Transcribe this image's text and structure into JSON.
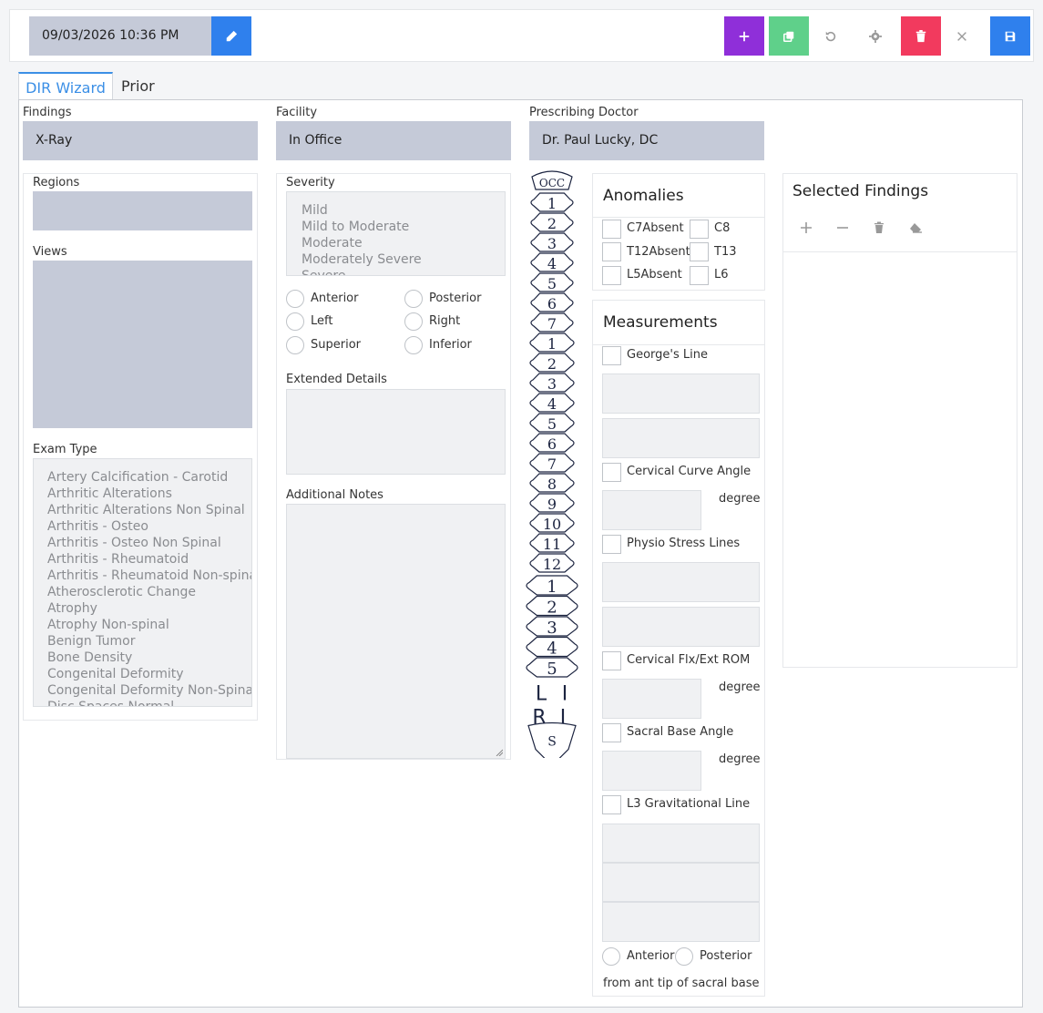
{
  "toolbar": {
    "datetime": "09/03/2026 10:36 PM",
    "icons": [
      "pencil-icon",
      "plus-icon",
      "copy-icon",
      "undo-icon",
      "gear-icon",
      "trash-icon",
      "close-icon",
      "save-icon"
    ],
    "colors": {
      "edit": "#2f80ed",
      "add": "#8f2fd9",
      "copy": "#5fd08a",
      "delete": "#f23a5e",
      "save": "#2f80ed"
    }
  },
  "tabs": [
    "DIR Wizard",
    "Prior"
  ],
  "findings": {
    "label": "Findings",
    "value": "X-Ray"
  },
  "facility": {
    "label": "Facility",
    "value": "In Office"
  },
  "doctor": {
    "label": "Prescribing Doctor",
    "value": "Dr. Paul Lucky, DC"
  },
  "regions": {
    "label": "Regions"
  },
  "views": {
    "label": "Views"
  },
  "exam": {
    "label": "Exam Type",
    "options": [
      "Artery Calcification - Carotid",
      "Arthritic Alterations",
      "Arthritic Alterations Non Spinal",
      "Arthritis - Osteo",
      "Arthritis - Osteo Non Spinal",
      "Arthritis - Rheumatoid",
      "Arthritis - Rheumatoid Non-spina",
      "Atherosclerotic Change",
      "Atrophy",
      "Atrophy Non-spinal",
      "Benign Tumor",
      "Bone Density",
      "Congenital Deformity",
      "Congenital Deformity Non-Spinal",
      "Disc Spaces Normal"
    ]
  },
  "severity": {
    "label": "Severity",
    "options": [
      "Mild",
      "Mild to Moderate",
      "Moderate",
      "Moderately Severe",
      "Severe"
    ],
    "radios": [
      "Anterior",
      "Posterior",
      "Left",
      "Right",
      "Superior",
      "Inferior"
    ]
  },
  "extended": {
    "label": "Extended Details"
  },
  "notes": {
    "label": "Additional Notes"
  },
  "spine": {
    "top": "OCC",
    "cervical": [
      "1",
      "2",
      "3",
      "4",
      "5",
      "6",
      "7"
    ],
    "thoracic": [
      "1",
      "2",
      "3",
      "4",
      "5",
      "6",
      "7",
      "8",
      "9",
      "10",
      "11",
      "12"
    ],
    "lumbar": [
      "1",
      "2",
      "3",
      "4",
      "5"
    ],
    "sacroiliac": [
      "L",
      "I",
      "R",
      "I"
    ],
    "sacrum": "S",
    "ink": "#1c2440"
  },
  "anomalies": {
    "title": "Anomalies",
    "items": [
      "C7Absent",
      "C8",
      "T12Absent",
      "T13",
      "L5Absent",
      "L6"
    ]
  },
  "measurements": {
    "title": "Measurements",
    "georges": "George's Line",
    "cervical_curve": "Cervical Curve Angle",
    "physio": "Physio Stress Lines",
    "cervical_flx": "Cervical Flx/Ext ROM",
    "sacral_base": "Sacral Base Angle",
    "l3": "L3 Gravitational Line",
    "unit": "degree",
    "anterior": "Anterior",
    "posterior": "Posterior",
    "note": "from ant tip of sacral base"
  },
  "selected": {
    "title": "Selected Findings",
    "icons": [
      "plus-icon",
      "minus-icon",
      "trash-icon",
      "eraser-icon"
    ]
  }
}
